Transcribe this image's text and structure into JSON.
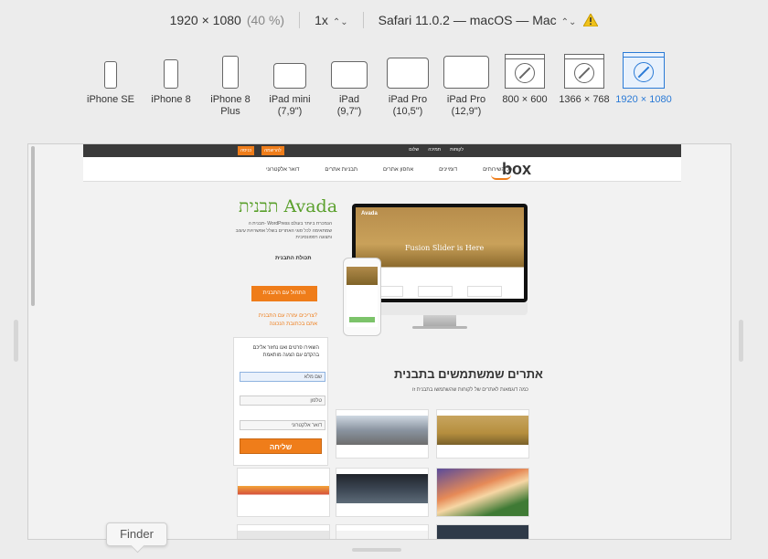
{
  "toolbar": {
    "resolution": "1920 × 1080",
    "percent": "(40 %)",
    "scale": "1x",
    "browser": "Safari 11.0.2 — macOS — Mac"
  },
  "devices": [
    {
      "label": "iPhone SE",
      "icon": "iphone-icon"
    },
    {
      "label": "iPhone 8",
      "icon": "iphone-icon"
    },
    {
      "label": "iPhone 8 Plus",
      "icon": "iphone-icon"
    },
    {
      "label": "iPad mini (7,9\")",
      "icon": "ipad-icon"
    },
    {
      "label": "iPad (9,7\")",
      "icon": "ipad-icon"
    },
    {
      "label": "iPad Pro (10,5\")",
      "icon": "ipad-icon"
    },
    {
      "label": "iPad Pro (12,9\")",
      "icon": "ipad-icon"
    },
    {
      "label": "800 × 600",
      "icon": "safari-window-icon"
    },
    {
      "label": "1366 × 768",
      "icon": "safari-window-icon"
    },
    {
      "label": "1920 × 1080",
      "icon": "safari-window-icon",
      "active": true
    }
  ],
  "site": {
    "topbar_links": [
      "שלום",
      "תמיכה",
      "לקוחות"
    ],
    "btn_a": "כניסה",
    "btn_b": "להרשמה",
    "logo": "box",
    "nav": [
      "כל השירותים",
      "דומיינים",
      "אחסון אתרים",
      "תבניות אתרים",
      "דואר אלקטרוני"
    ],
    "title": "תבנית Avada",
    "description": "תבנית ה- WordPress הנמכרת ביותר בעולם שמתאימה לכל סוגי האתרים בשלל אפשרויות עיצוב ותצוגה רספונסיבית",
    "features": "תכולת התבנית",
    "cta": "התחול עם התבנית",
    "help_line1": "צריכים עזרה עם התבנית?",
    "help_line2": "אתם בכתובת הנכונה",
    "hero_text": "Fusion Slider is Here",
    "imac_logo": "Avada",
    "form": {
      "title": "השאירו פרטים ואנו נחזור אליכם בהקדם עם הצעה מותאמת",
      "name": "שם מלא",
      "phone": "טלפון",
      "email": "דואר אלקטרוני",
      "send": "שליחה"
    },
    "section_title": "אתרים שמשתמשים בתבנית",
    "section_sub": "כמה דוגמאות לאתרים של לקוחות שהשתמשו בתבנית זו"
  },
  "tooltip": "Finder"
}
